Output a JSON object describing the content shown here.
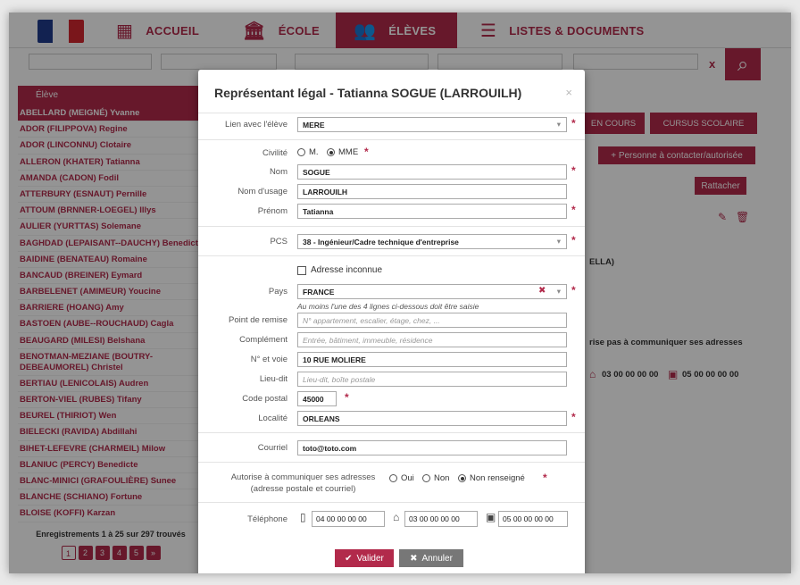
{
  "nav": {
    "items": [
      {
        "label": "ACCUEIL",
        "icon": "grid-icon"
      },
      {
        "label": "ÉCOLE",
        "icon": "building-icon"
      },
      {
        "label": "ÉLÈVES",
        "icon": "students-icon"
      },
      {
        "label": "LISTES & DOCUMENTS",
        "icon": "list-icon"
      }
    ],
    "search_clear": "x"
  },
  "list": {
    "header": "Élève",
    "rows": [
      "ABELLARD (MEIGNÉ) Yvanne",
      "ADOR (FILIPPOVA) Regine",
      "ADOR (LINCONNU) Clotaire",
      "ALLERON (KHATER) Tatianna",
      "AMANDA (CADON) Fodil",
      "ATTERBURY (ESNAUT) Pernille",
      "ATTOUM (BRNNER-LOEGEL) Illys",
      "AULIER (YURTTAS) Solemane",
      "BAGHDAD (LEPAISANT--DAUCHY) Benedicte",
      "BAIDINE (BENATEAU) Romaine",
      "BANCAUD (BREINER) Eymard",
      "BARBELENET (AMIMEUR) Youcine",
      "BARRIERE (HOANG) Amy",
      "BASTOEN (AUBE--ROUCHAUD) Cagla",
      "BEAUGARD (MILESI) Belshana",
      "BENOTMAN-MEZIANE (BOUTRY-DEBEAUMOREL) Christel",
      "BERTIAU (LENICOLAIS) Audren",
      "BERTON-VIEL (RUBES) Tifany",
      "BEUREL (THIRIOT) Wen",
      "BIELECKI (RAVIDA) Abdillahi",
      "BIHET-LEFEVRE (CHARMEIL) Milow",
      "BLANIUC (PERCY) Benedicte",
      "BLANC-MINICI (GRAFOULIÈRE) Sunee",
      "BLANCHE (SCHIANO) Fortune",
      "BLOISE (KOFFI) Karzan"
    ],
    "footer": "Enregistrements 1 à 25 sur 297 trouvés",
    "pages": [
      "1",
      "2",
      "3",
      "4",
      "5",
      "»"
    ]
  },
  "right": {
    "tab_en_cours": "EN COURS",
    "tab_cursus": "CURSUS SCOLAIRE",
    "btn_personne": "+ Personne à contacter/autorisée",
    "btn_rattacher": "Rattacher",
    "text_ella": "ELLA)",
    "text_communiquer": "rise pas à communiquer ses adresses",
    "phone_home": "03 00 00 00 00",
    "phone_work": "05 00 00 00 00"
  },
  "modal": {
    "title": "Représentant légal - Tatianna SOGUE (LARROUILH)",
    "close": "×",
    "lien_label": "Lien avec l'élève",
    "lien_value": "MERE",
    "civilite_label": "Civilité",
    "civilite_m": "M.",
    "civilite_mme": "MME",
    "nom_label": "Nom",
    "nom_value": "SOGUE",
    "nom_usage_label": "Nom d'usage",
    "nom_usage_value": "LARROUILH",
    "prenom_label": "Prénom",
    "prenom_value": "Tatianna",
    "pcs_label": "PCS",
    "pcs_value": "38 - Ingénieur/Cadre technique d'entreprise",
    "adresse_inconnue": "Adresse inconnue",
    "pays_label": "Pays",
    "pays_value": "FRANCE",
    "note": "Au moins l'une des 4 lignes ci-dessous doit être saisie",
    "remise_label": "Point de remise",
    "remise_ph": "N° appartement, escalier, étage, chez, ...",
    "complement_label": "Complément",
    "complement_ph": "Entrée, bâtiment, immeuble, résidence",
    "voie_label": "N° et voie",
    "voie_value": "10 RUE MOLIERE",
    "lieudit_label": "Lieu-dit",
    "lieudit_ph": "Lieu-dit, boîte postale",
    "cp_label": "Code postal",
    "cp_value": "45000",
    "localite_label": "Localité",
    "localite_value": "ORLEANS",
    "courriel_label": "Courriel",
    "courriel_value": "toto@toto.com",
    "autorise_label": "Autorise à communiquer ses adresses",
    "autorise_sub": "(adresse postale et courriel)",
    "oui": "Oui",
    "non": "Non",
    "non_renseigne": "Non renseigné",
    "tel_label": "Téléphone",
    "tel_mobile": "04 00 00 00 00",
    "tel_home": "03 00 00 00 00",
    "tel_work": "05 00 00 00 00",
    "valider": "Valider",
    "annuler": "Annuler",
    "req": "*"
  },
  "colors": {
    "accent": "#b22a4b"
  }
}
